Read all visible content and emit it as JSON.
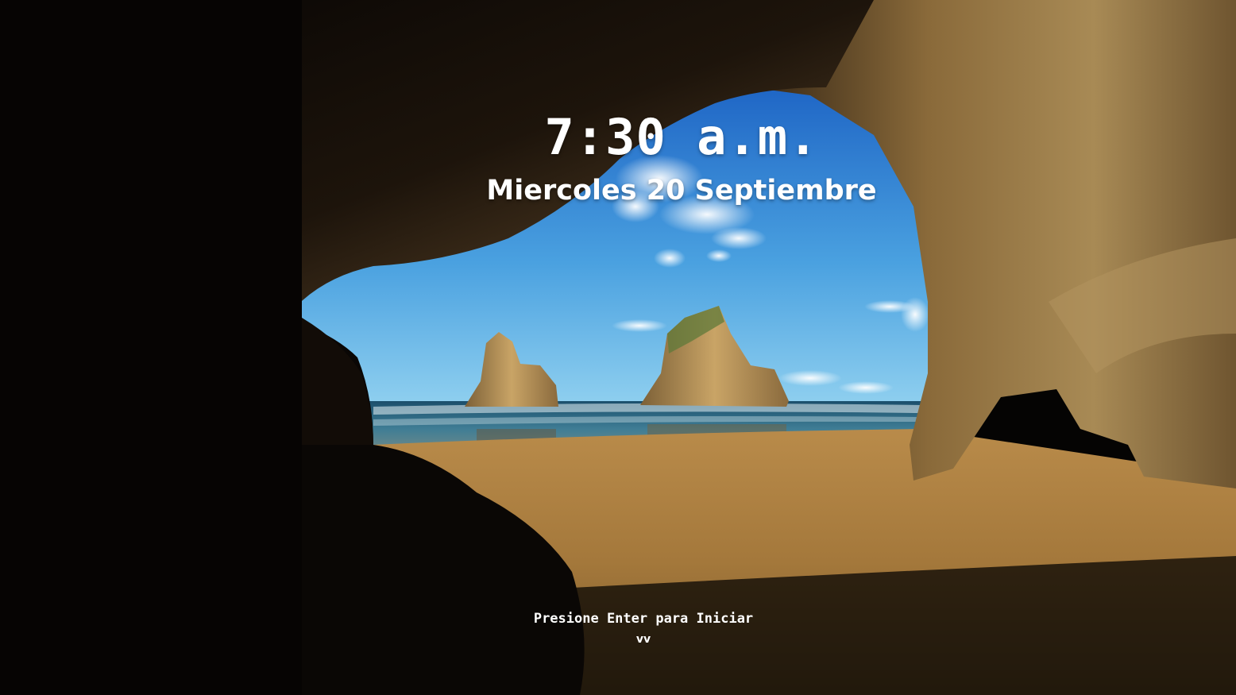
{
  "lockscreen": {
    "time": "7:30 a.m.",
    "date": "Miercoles 20 Septiembre",
    "prompt": "Presione Enter para Iniciar",
    "chevron": "vv"
  },
  "colors": {
    "sky_top": "#1f6fcf",
    "sky_horizon": "#7cc6ee",
    "sea": "#1d5a7a",
    "sand": "#a57a3c",
    "rock": "#9a7a48",
    "cave": "#070504",
    "text": "#ffffff"
  }
}
